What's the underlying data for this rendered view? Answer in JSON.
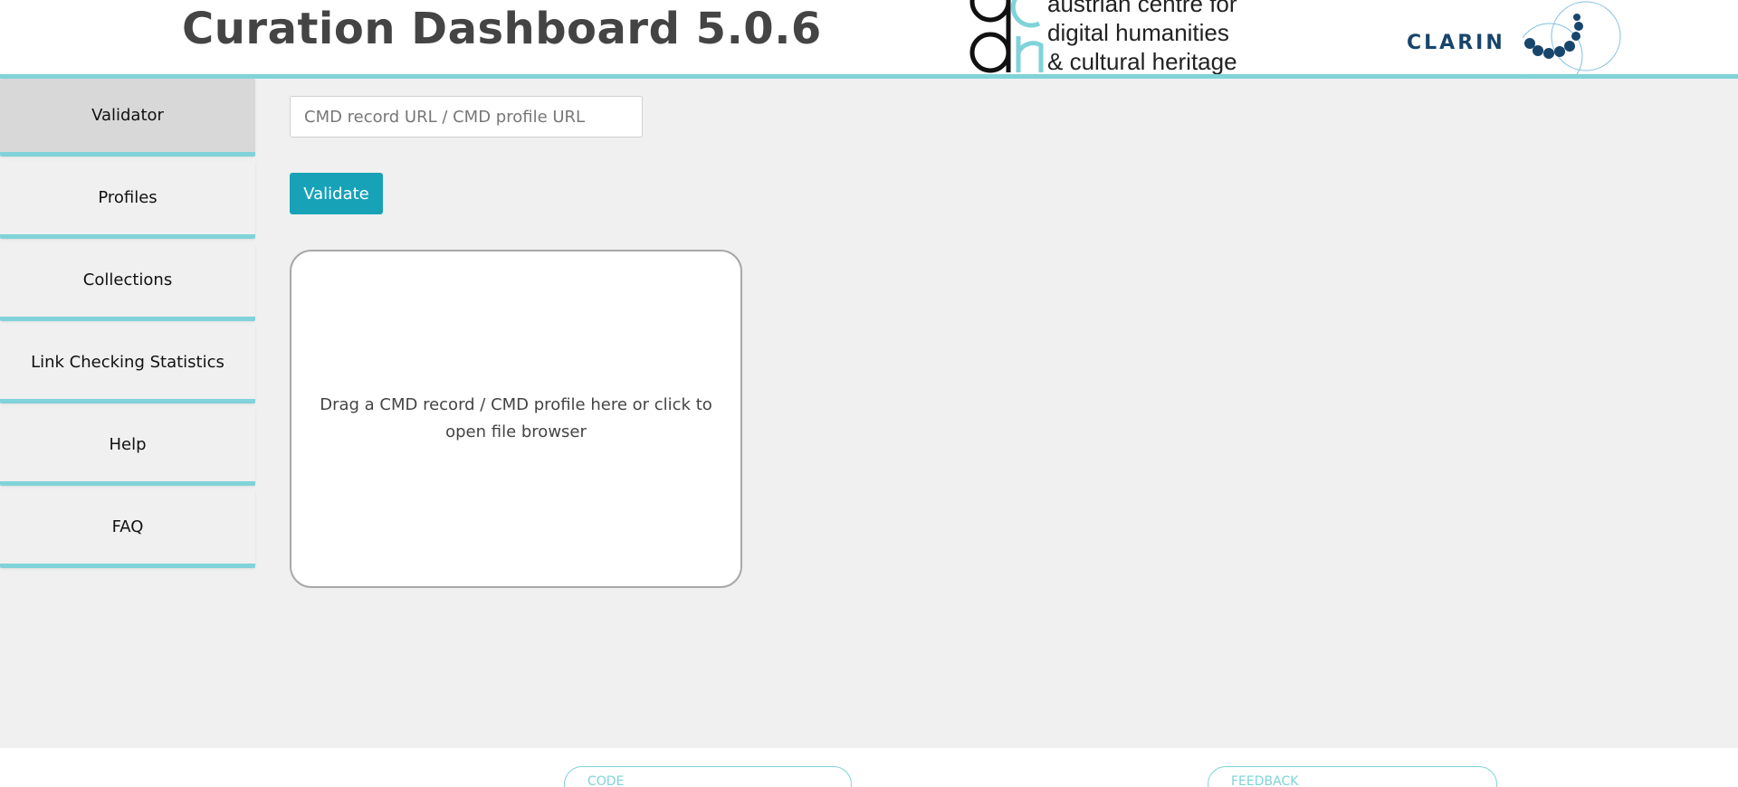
{
  "header": {
    "title": "Curation Dashboard 5.0.6",
    "acdh_logo_lines": [
      "austrian centre for",
      "digital humanities",
      "& cultural heritage"
    ],
    "clarin_logo_text": "CLARIN"
  },
  "sidebar": {
    "items": [
      {
        "label": "Validator",
        "active": true
      },
      {
        "label": "Profiles",
        "active": false
      },
      {
        "label": "Collections",
        "active": false
      },
      {
        "label": "Link Checking Statistics",
        "active": false
      },
      {
        "label": "Help",
        "active": false
      },
      {
        "label": "FAQ",
        "active": false
      }
    ]
  },
  "main": {
    "url_input": {
      "placeholder": "CMD record URL / CMD profile URL",
      "value": ""
    },
    "validate_label": "Validate",
    "dropzone_text": "Drag a CMD record / CMD profile here or click to open file browser"
  },
  "footer": {
    "code_label": "CODE",
    "feedback_label": "FEEDBACK"
  },
  "colors": {
    "accent": "#7fd3d9",
    "button": "#17a2b8",
    "title": "#444444",
    "clarin_blue": "#18456b",
    "background": "#f0f0f0"
  }
}
